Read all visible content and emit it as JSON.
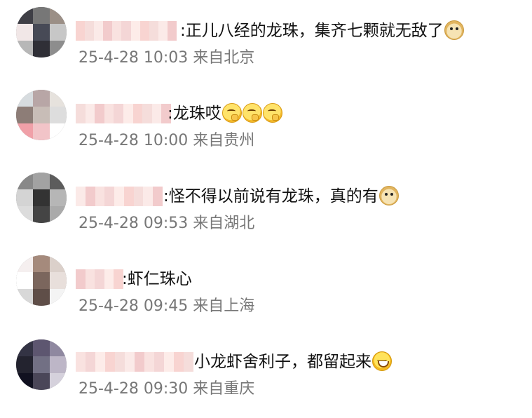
{
  "comments": [
    {
      "name_blurred": true,
      "text": ":正儿八经的龙珠，集齐七颗就无敌了",
      "emoji": "doge-emoji",
      "datetime": "25-4-28 10:03",
      "location": "来自北京"
    },
    {
      "name_blurred": true,
      "text": ":龙珠哎",
      "emoji": "think-emoji",
      "datetime": "25-4-28 10:00",
      "location": "来自贵州"
    },
    {
      "name_blurred": true,
      "text": ":怪不得以前说有龙珠，真的有",
      "emoji": "doge-emoji",
      "datetime": "25-4-28 09:53",
      "location": "来自湖北"
    },
    {
      "name_blurred": true,
      "text": ":虾仁珠心",
      "emoji": "",
      "datetime": "25-4-28 09:45",
      "location": "来自上海"
    },
    {
      "name_blurred": true,
      "text": "小龙虾舍利子，都留起来",
      "emoji": "laugh-emoji",
      "datetime": "25-4-28 09:30",
      "location": "来自重庆"
    }
  ],
  "colors": {
    "text": "#111111",
    "meta": "#777777",
    "blur_pink": "#f2c5c5"
  }
}
